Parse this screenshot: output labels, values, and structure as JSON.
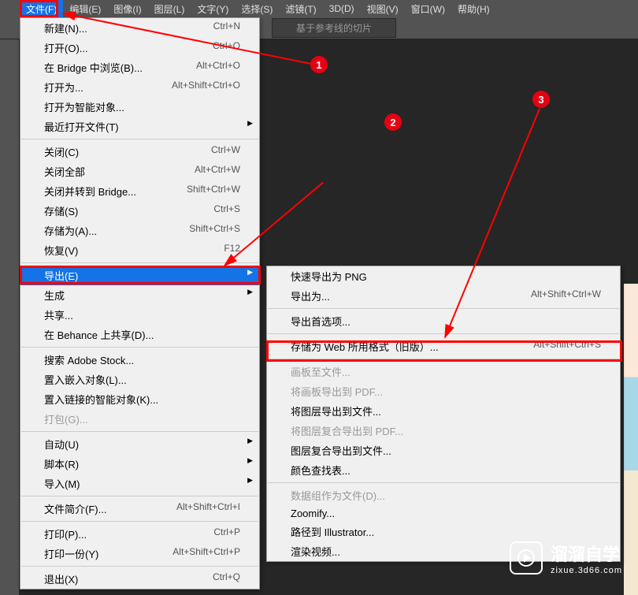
{
  "menubar": {
    "items": [
      {
        "label": "文件(F)",
        "active": true
      },
      {
        "label": "编辑(E)"
      },
      {
        "label": "图像(I)"
      },
      {
        "label": "图层(L)"
      },
      {
        "label": "文字(Y)"
      },
      {
        "label": "选择(S)"
      },
      {
        "label": "滤镜(T)"
      },
      {
        "label": "3D(D)"
      },
      {
        "label": "视图(V)"
      },
      {
        "label": "窗口(W)"
      },
      {
        "label": "帮助(H)"
      }
    ]
  },
  "toolbar": {
    "slice_guide_btn": "基于参考线的切片"
  },
  "file_menu": {
    "items": [
      {
        "label": "新建(N)...",
        "shortcut": "Ctrl+N"
      },
      {
        "label": "打开(O)...",
        "shortcut": "Ctrl+O"
      },
      {
        "label": "在 Bridge 中浏览(B)...",
        "shortcut": "Alt+Ctrl+O"
      },
      {
        "label": "打开为...",
        "shortcut": "Alt+Shift+Ctrl+O"
      },
      {
        "label": "打开为智能对象..."
      },
      {
        "label": "最近打开文件(T)",
        "submenu": true
      },
      {
        "sep": true
      },
      {
        "label": "关闭(C)",
        "shortcut": "Ctrl+W"
      },
      {
        "label": "关闭全部",
        "shortcut": "Alt+Ctrl+W"
      },
      {
        "label": "关闭并转到 Bridge...",
        "shortcut": "Shift+Ctrl+W"
      },
      {
        "label": "存储(S)",
        "shortcut": "Ctrl+S"
      },
      {
        "label": "存储为(A)...",
        "shortcut": "Shift+Ctrl+S"
      },
      {
        "label": "恢复(V)",
        "shortcut": "F12"
      },
      {
        "sep": true
      },
      {
        "label": "导出(E)",
        "submenu": true,
        "highlighted": true
      },
      {
        "label": "生成",
        "submenu": true
      },
      {
        "label": "共享..."
      },
      {
        "label": "在 Behance 上共享(D)..."
      },
      {
        "sep": true
      },
      {
        "label": "搜索 Adobe Stock..."
      },
      {
        "label": "置入嵌入对象(L)..."
      },
      {
        "label": "置入链接的智能对象(K)..."
      },
      {
        "label": "打包(G)...",
        "disabled": true
      },
      {
        "sep": true
      },
      {
        "label": "自动(U)",
        "submenu": true
      },
      {
        "label": "脚本(R)",
        "submenu": true
      },
      {
        "label": "导入(M)",
        "submenu": true
      },
      {
        "sep": true
      },
      {
        "label": "文件简介(F)...",
        "shortcut": "Alt+Shift+Ctrl+I"
      },
      {
        "sep": true
      },
      {
        "label": "打印(P)...",
        "shortcut": "Ctrl+P"
      },
      {
        "label": "打印一份(Y)",
        "shortcut": "Alt+Shift+Ctrl+P"
      },
      {
        "sep": true
      },
      {
        "label": "退出(X)",
        "shortcut": "Ctrl+Q"
      }
    ]
  },
  "export_menu": {
    "items": [
      {
        "label": "快速导出为 PNG"
      },
      {
        "label": "导出为...",
        "shortcut": "Alt+Shift+Ctrl+W"
      },
      {
        "sep": true
      },
      {
        "label": "导出首选项..."
      },
      {
        "sep": true
      },
      {
        "label": "存储为 Web 所用格式（旧版）...",
        "shortcut": "Alt+Shift+Ctrl+S"
      },
      {
        "sep": true
      },
      {
        "label": "画板至文件...",
        "disabled": true
      },
      {
        "label": "将画板导出到 PDF...",
        "disabled": true
      },
      {
        "label": "将图层导出到文件..."
      },
      {
        "label": "将图层复合导出到 PDF...",
        "disabled": true
      },
      {
        "label": "图层复合导出到文件..."
      },
      {
        "label": "颜色查找表..."
      },
      {
        "sep": true
      },
      {
        "label": "数据组作为文件(D)...",
        "disabled": true
      },
      {
        "label": "Zoomify..."
      },
      {
        "label": "路径到 Illustrator..."
      },
      {
        "label": "渲染视频..."
      }
    ]
  },
  "markers": {
    "m1": "1",
    "m2": "2",
    "m3": "3"
  },
  "watermark": {
    "main": "溜溜自学",
    "sub": "zixue.3d66.com"
  }
}
